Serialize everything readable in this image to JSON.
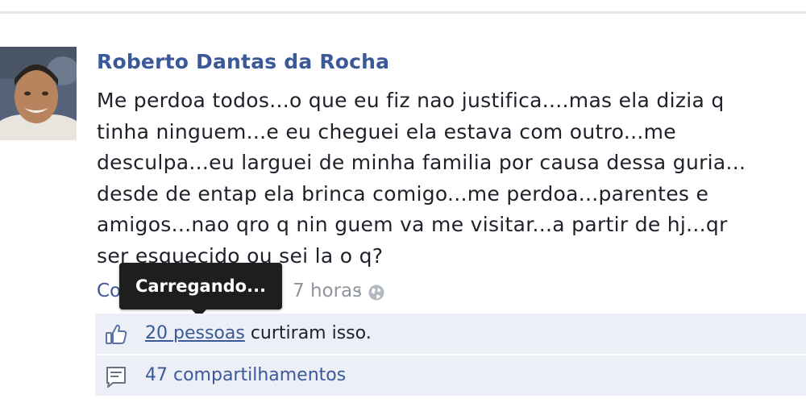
{
  "post": {
    "author_name": "Roberto Dantas da Rocha",
    "body_lines": [
      "Me perdoa todos...o que eu fiz nao justifica....mas ela dizia q",
      "tinha ninguem...e eu cheguei ela estava com outro...me",
      "desculpa...eu larguei de minha familia por causa dessa guria...",
      "desde de entap ela brinca comigo...me perdoa...parentes e",
      "amigos...nao qro q nin guem va me visitar...a partir de hj...qr",
      "ser esquecido ou sei la o q?"
    ],
    "meta": {
      "link_text": "Co",
      "time_text": "7 horas",
      "separator": "·"
    }
  },
  "tooltip": {
    "text": "Carregando..."
  },
  "likes": {
    "count_text": "20 pessoas",
    "suffix": "curtiram isso."
  },
  "shares": {
    "text": "47 compartilhamentos"
  },
  "icons": {
    "avatar": "profile-photo",
    "privacy": "globe-icon",
    "like": "thumbs-up-icon",
    "share": "share-icon"
  },
  "colors": {
    "link": "#3b5998",
    "text": "#1d2129",
    "muted": "#90949c",
    "ufi_background": "#eceff5",
    "tooltip_background": "#1e1e1e"
  }
}
